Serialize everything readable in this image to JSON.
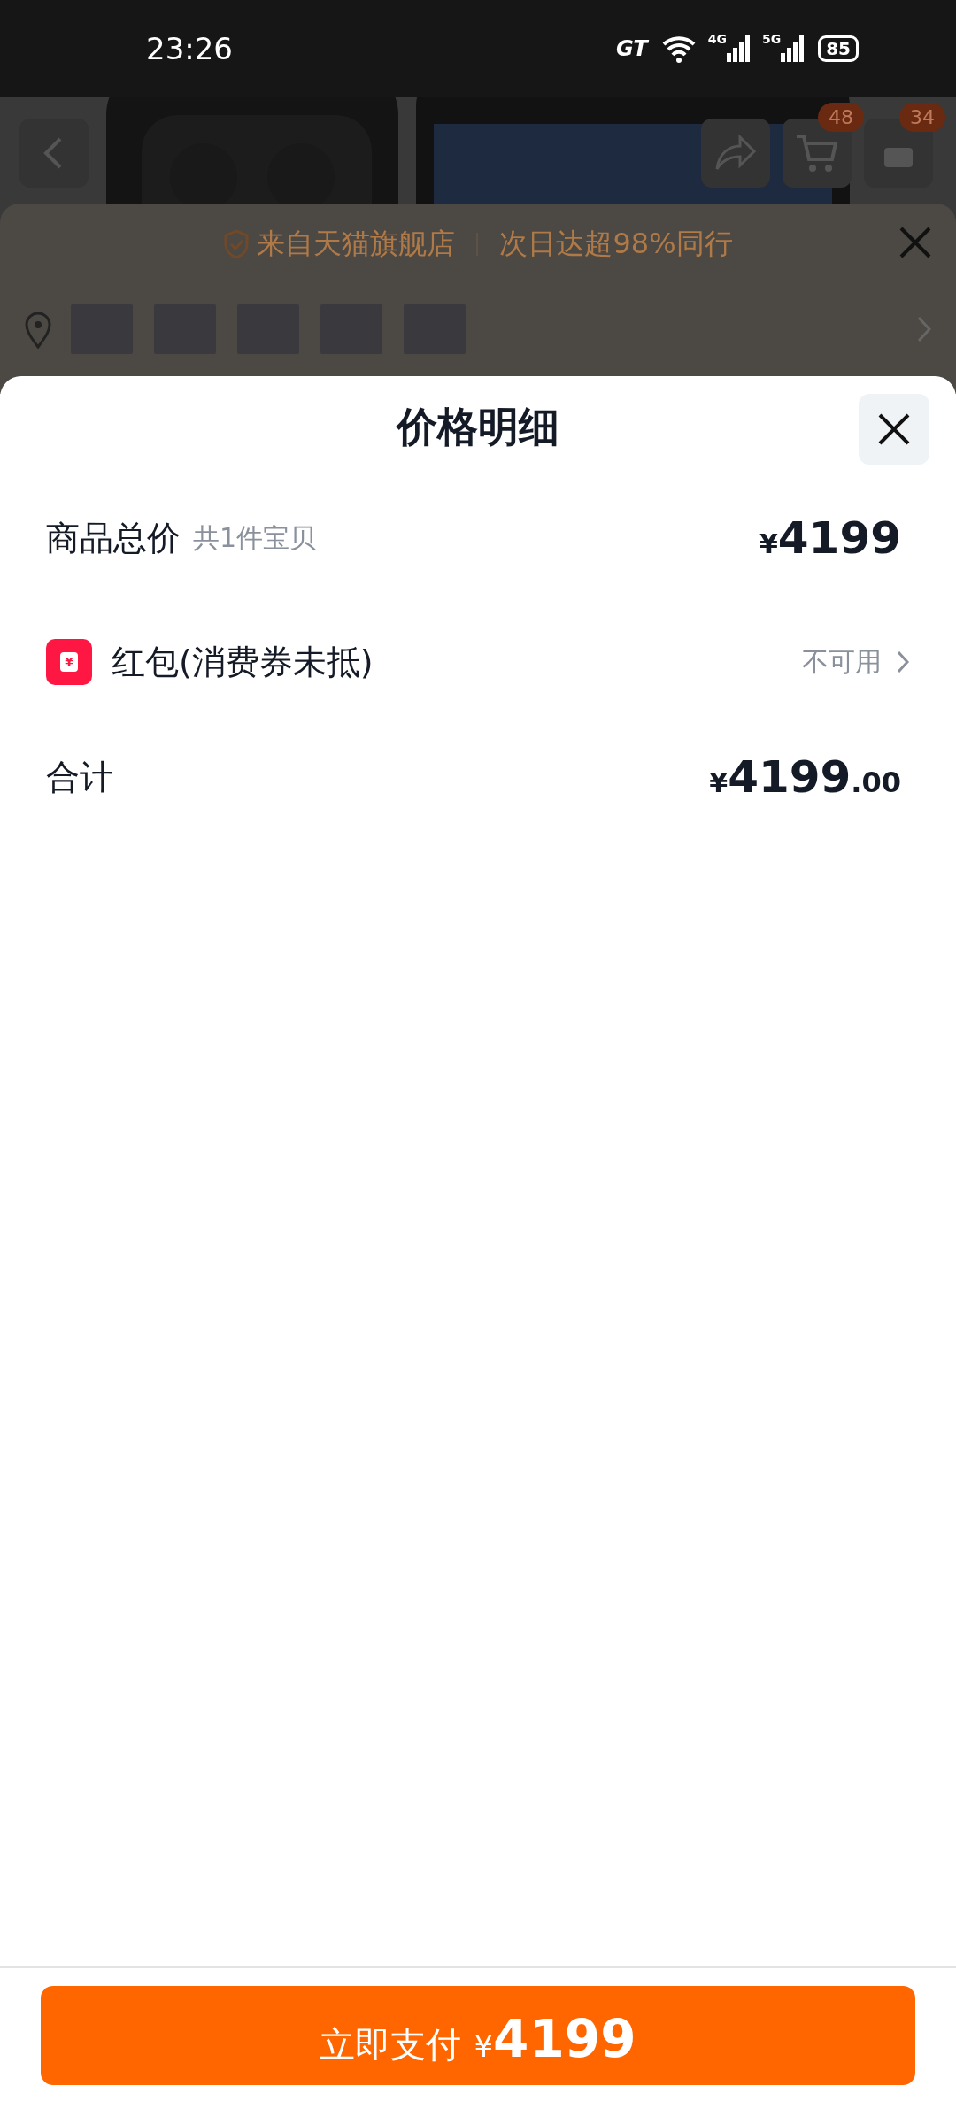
{
  "status_bar": {
    "time": "23:26",
    "network_badge": "GT",
    "signals": [
      {
        "label": "4G"
      },
      {
        "label": "5G"
      }
    ],
    "battery": "85"
  },
  "background_page": {
    "badges": [
      {
        "count": "48"
      },
      {
        "count": "34"
      }
    ],
    "banner": {
      "store": "来自天猫旗舰店",
      "delivery": "次日达超98%同行"
    }
  },
  "sheet": {
    "title": "价格明细",
    "rows": [
      {
        "kind": "item",
        "label": "商品总价",
        "note": "共1件宝贝",
        "currency": "¥",
        "amount": "4199"
      },
      {
        "kind": "coupon",
        "icon_text": "¥",
        "label": "红包(消费券未抵)",
        "status": "不可用"
      },
      {
        "kind": "total",
        "label": "合计",
        "currency": "¥",
        "amount": "4199",
        "decimals": ".00"
      }
    ]
  },
  "pay_button": {
    "label": "立即支付",
    "currency": "¥",
    "amount": "4199"
  }
}
